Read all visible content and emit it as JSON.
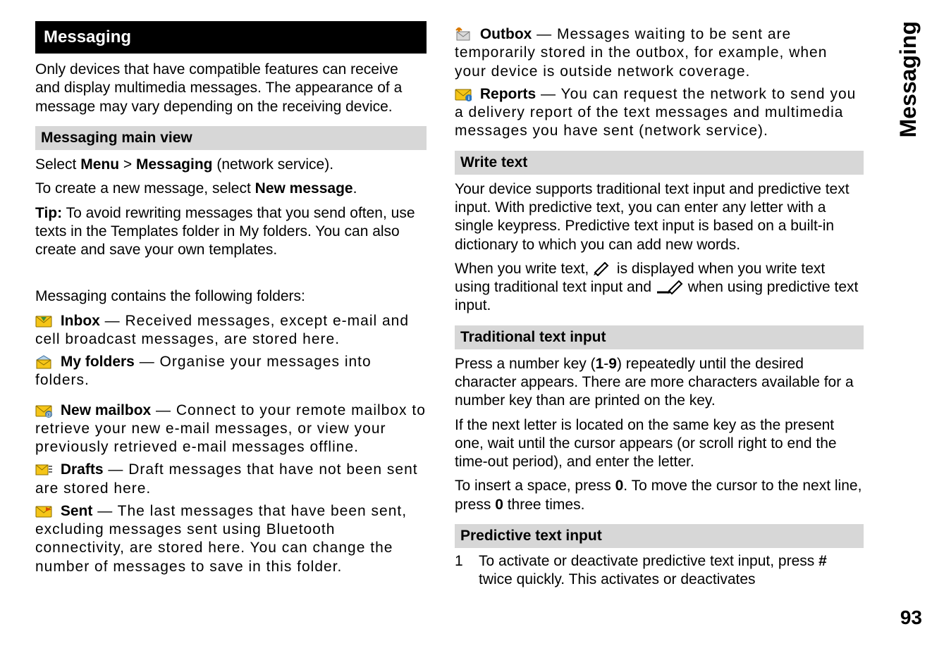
{
  "page_number": "93",
  "side_tab": "Messaging",
  "left": {
    "title": "Messaging",
    "intro": "Only devices that have compatible features can receive and display multimedia messages. The appearance of a message may vary depending on the receiving device.",
    "h_main_view": "Messaging main view",
    "select_line_prefix": "Select ",
    "select_menu": "Menu",
    "select_gt": " > ",
    "select_messaging": "Messaging",
    "select_suffix": " (network service).",
    "new_msg_prefix": "To create a new message, select ",
    "new_msg_bold": "New message",
    "new_msg_suffix": ".",
    "tip_label": "Tip:",
    "tip_body": " To avoid rewriting messages that you send often, use texts in the Templates folder in My folders. You can also create and save your own templates.",
    "folders_intro": "Messaging contains the following folders:",
    "folders": {
      "inbox": {
        "name": "Inbox",
        "desc": " — Received messages, except e-mail and cell broadcast messages, are stored here."
      },
      "myfolders": {
        "name": "My folders",
        "desc": " — Organise your messages into folders."
      },
      "newmailbox": {
        "name": "New mailbox",
        "desc": " — Connect to your remote mailbox to retrieve your new e-mail messages, or view your previously retrieved e-mail messages offline."
      },
      "drafts": {
        "name": "Drafts",
        "desc": " — Draft messages that have not been sent are stored here."
      },
      "sent": {
        "name": "Sent",
        "desc": " — The last messages that have been sent, excluding messages sent using Bluetooth connectivity, are stored here. You can change the number of messages to save in this folder."
      }
    }
  },
  "right": {
    "folders": {
      "outbox": {
        "name": "Outbox",
        "desc": " — Messages waiting to be sent are temporarily stored in the outbox, for example, when your device is outside network coverage."
      },
      "reports": {
        "name": "Reports",
        "desc": " — You can request the network to send you a delivery report of the text messages and multimedia messages you have sent (network service)."
      }
    },
    "h_write_text": "Write text",
    "write_text_para": "Your device supports traditional text input and predictive text input. With predictive text, you can enter any letter with a single keypress. Predictive text input is based on a built-in dictionary to which you can add new words.",
    "write_text_inline_a": "When you write text, ",
    "write_text_inline_b": " is displayed when you write text using traditional text input and ",
    "write_text_inline_c": " when using predictive text input.",
    "h_traditional": "Traditional text input",
    "trad_p1_a": "Press a number key (",
    "trad_p1_b": "1",
    "trad_p1_c": "-",
    "trad_p1_d": "9",
    "trad_p1_e": ") repeatedly until the desired character appears. There are more characters available for a number key than are printed on the key.",
    "trad_p2": "If the next letter is located on the same key as the present one, wait until the cursor appears (or scroll right to end the time-out period), and enter the letter.",
    "trad_p3_a": "To insert a space, press ",
    "trad_p3_b": "0",
    "trad_p3_c": ". To move the cursor to the next line, press ",
    "trad_p3_d": "0",
    "trad_p3_e": " three times.",
    "h_predictive": "Predictive text input",
    "pred_item_num": "1",
    "pred_item_a": "To activate or deactivate predictive text input, press ",
    "pred_item_b": "#",
    "pred_item_c": " twice quickly. This activates or deactivates"
  }
}
